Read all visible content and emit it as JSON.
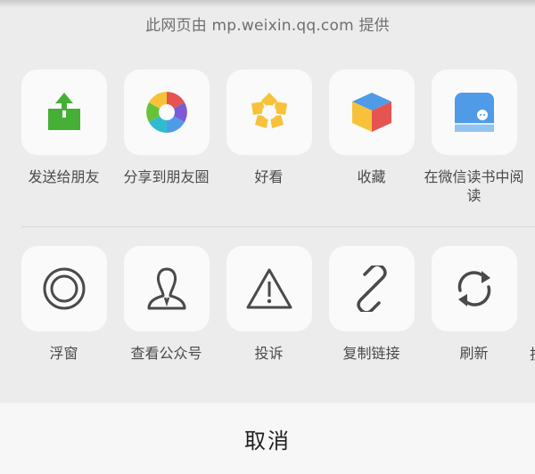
{
  "header": {
    "source_text": "此网页由 mp.weixin.qq.com 提供"
  },
  "share_row": [
    {
      "label": "发送给朋友",
      "icon": "share-upload-icon"
    },
    {
      "label": "分享到朋友圈",
      "icon": "moments-aperture-icon"
    },
    {
      "label": "好看",
      "icon": "wow-star-icon"
    },
    {
      "label": "收藏",
      "icon": "favorites-cube-icon"
    },
    {
      "label": "在微信读书中阅读",
      "icon": "weread-book-icon"
    }
  ],
  "tool_row": [
    {
      "label": "浮窗",
      "icon": "float-window-icon"
    },
    {
      "label": "查看公众号",
      "icon": "official-account-icon"
    },
    {
      "label": "投诉",
      "icon": "warning-triangle-icon"
    },
    {
      "label": "复制链接",
      "icon": "link-icon"
    },
    {
      "label": "刷新",
      "icon": "refresh-icon"
    }
  ],
  "partial_label": "投",
  "cancel_label": "取消",
  "colors": {
    "green": "#45b035",
    "blue": "#4f9be8",
    "yellow": "#f7c23a",
    "red": "#e6544f"
  }
}
